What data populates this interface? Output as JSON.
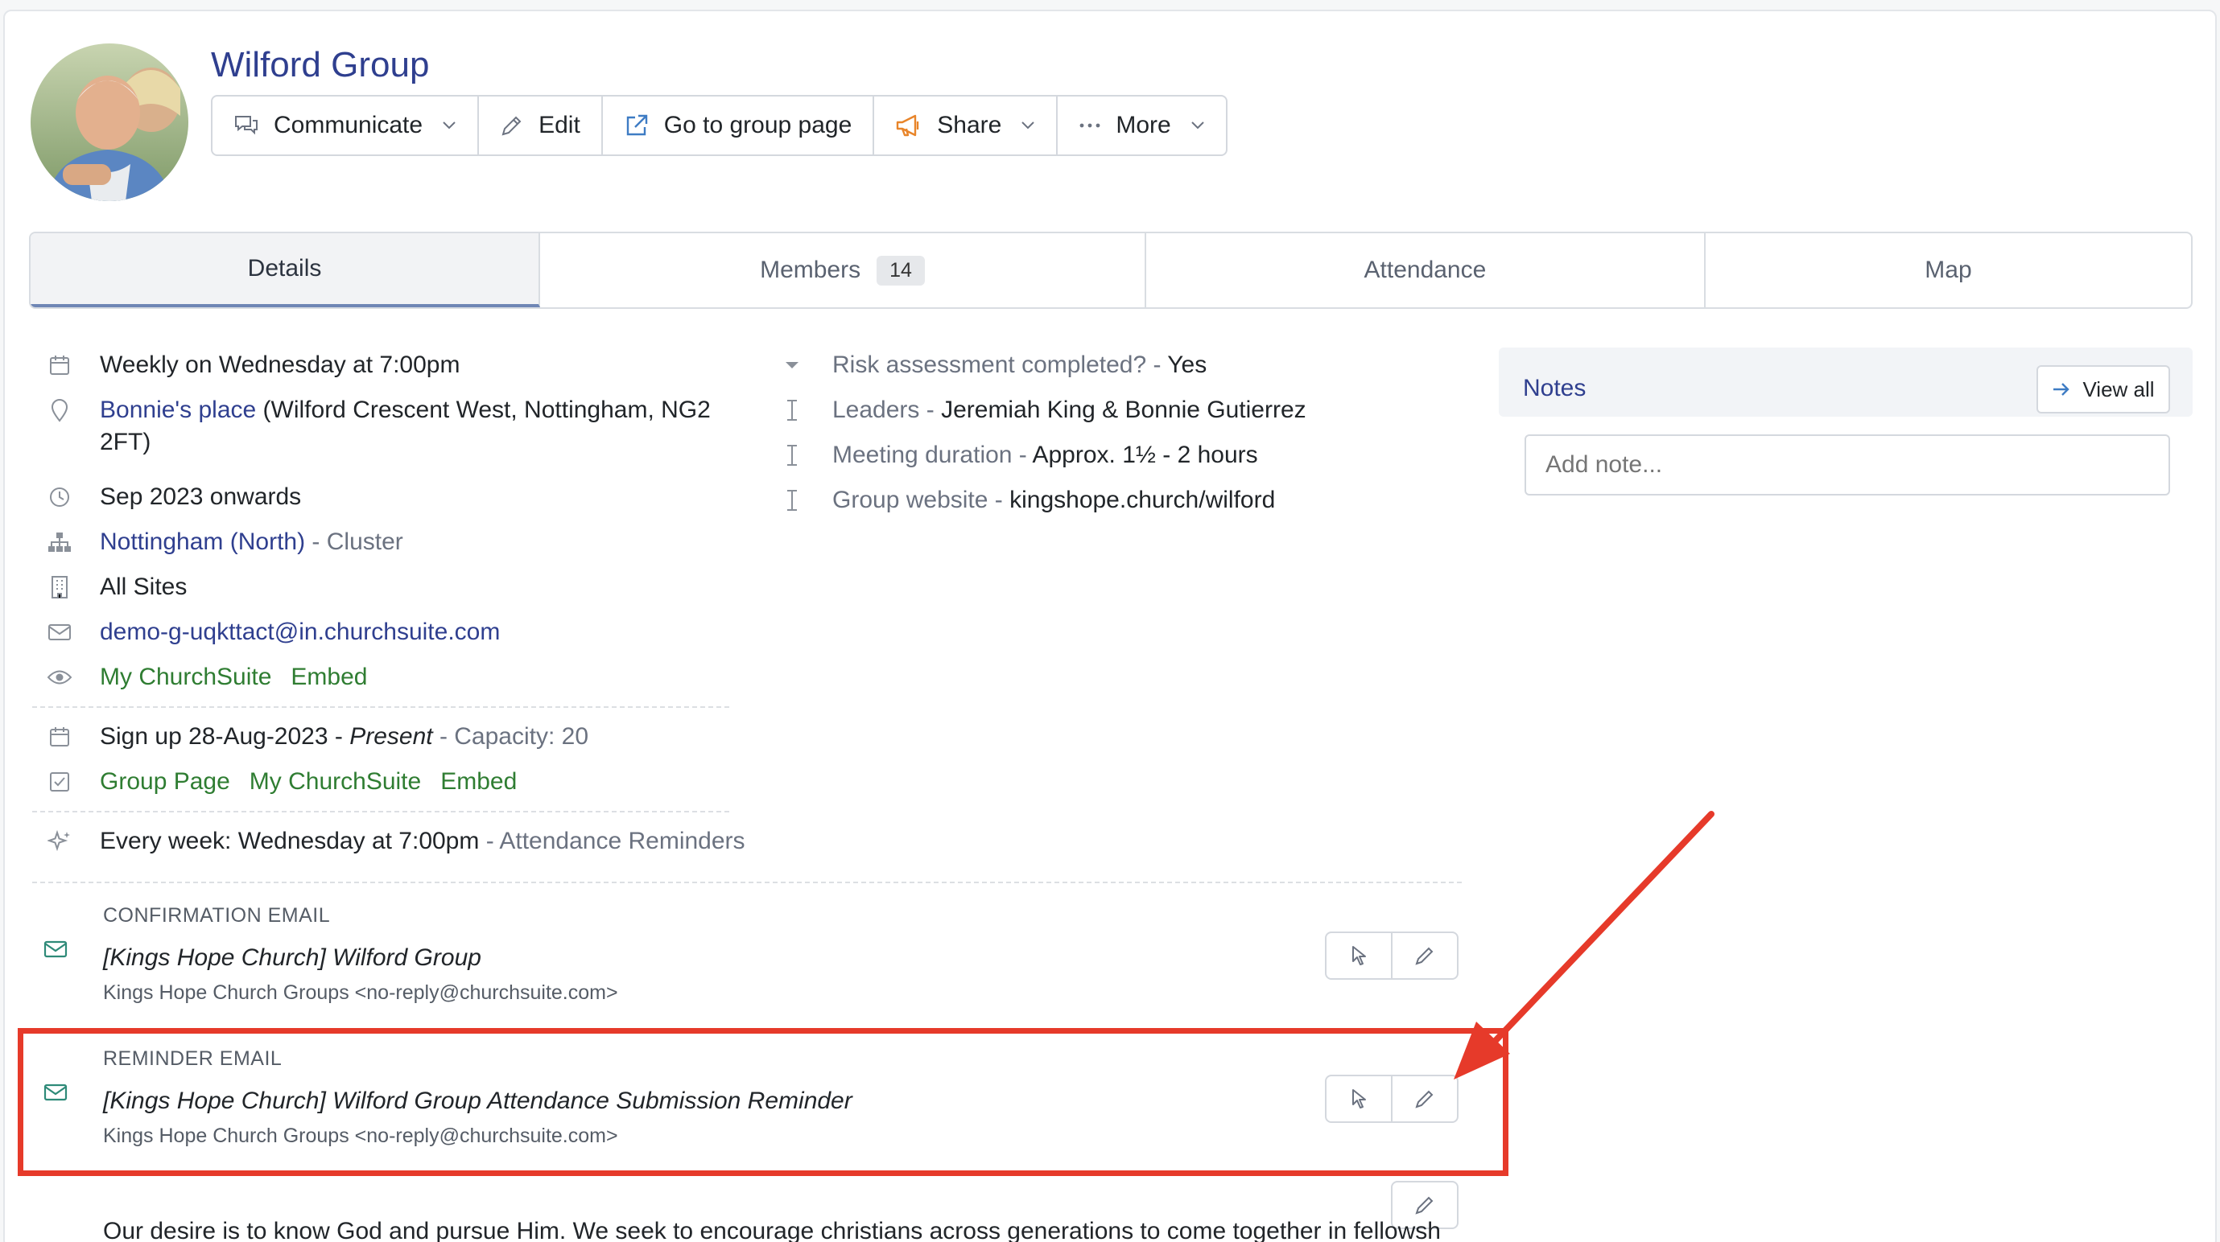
{
  "header": {
    "title": "Wilford Group",
    "avatar_alt": "",
    "toolbar": [
      {
        "id": "communicate",
        "label": "Communicate",
        "icon": "chat-icon",
        "dropdown": true
      },
      {
        "id": "edit",
        "label": "Edit",
        "icon": "pencil-icon",
        "dropdown": false
      },
      {
        "id": "group-page",
        "label": "Go to group page",
        "icon": "external-link-icon",
        "dropdown": false
      },
      {
        "id": "share",
        "label": "Share",
        "icon": "megaphone-icon",
        "dropdown": true
      },
      {
        "id": "more",
        "label": "More",
        "icon": "ellipsis-icon",
        "dropdown": true
      }
    ]
  },
  "tabs": [
    {
      "label": "Details",
      "active": true
    },
    {
      "label": "Members",
      "count": "14"
    },
    {
      "label": "Attendance"
    },
    {
      "label": "Map"
    }
  ],
  "details": {
    "schedule": "Weekly on Wednesday at 7:00pm",
    "location_link": "Bonnie's place",
    "location_address_1": " (Wilford Crescent West, Nottingham, NG2",
    "location_address_2": "2FT)",
    "start": "Sep 2023 onwards",
    "cluster_link": "Nottingham (North)",
    "cluster_suffix": " - Cluster",
    "sites": "All Sites",
    "email": "demo-g-uqkttact@in.churchsuite.com",
    "visibility": [
      "My ChurchSuite",
      "Embed"
    ],
    "signup_text": "Sign up 28-Aug-2023 - ",
    "signup_present": "Present",
    "signup_capacity": " - Capacity: 20",
    "signup_links": [
      "Group Page",
      "My ChurchSuite",
      "Embed"
    ],
    "reminder_text": "Every week: Wednesday at 7:00pm",
    "reminder_suffix": " - Attendance Reminders"
  },
  "custom_fields": [
    {
      "label": "Risk assessment completed? - ",
      "value": "Yes",
      "icon": "caret-down-icon"
    },
    {
      "label": "Leaders - ",
      "value": "Jeremiah King & Bonnie Gutierrez",
      "icon": "text-cursor-icon"
    },
    {
      "label": "Meeting duration - ",
      "value": "Approx. 1½ - 2 hours",
      "icon": "text-cursor-icon"
    },
    {
      "label": "Group website - ",
      "value": "kingshope.church/wilford",
      "icon": "text-cursor-icon"
    }
  ],
  "notes": {
    "title": "Notes",
    "view_all": "View all",
    "placeholder": "Add note..."
  },
  "emails": {
    "confirmation": {
      "label": "CONFIRMATION EMAIL",
      "subject": "[Kings Hope Church] Wilford Group",
      "from": "Kings Hope Church Groups  <no-reply@churchsuite.com>"
    },
    "reminder": {
      "label": "REMINDER EMAIL",
      "subject": "[Kings Hope Church] Wilford Group Attendance Submission Reminder",
      "from": "Kings Hope Church Groups  <no-reply@churchsuite.com>"
    }
  },
  "description": "Our desire is to know God and pursue Him. We seek to encourage christians across generations to come together in fellowship,",
  "colors": {
    "accent": "#2f3f8f",
    "link_green": "#2f7d32",
    "annotation": "#e63a2a"
  }
}
